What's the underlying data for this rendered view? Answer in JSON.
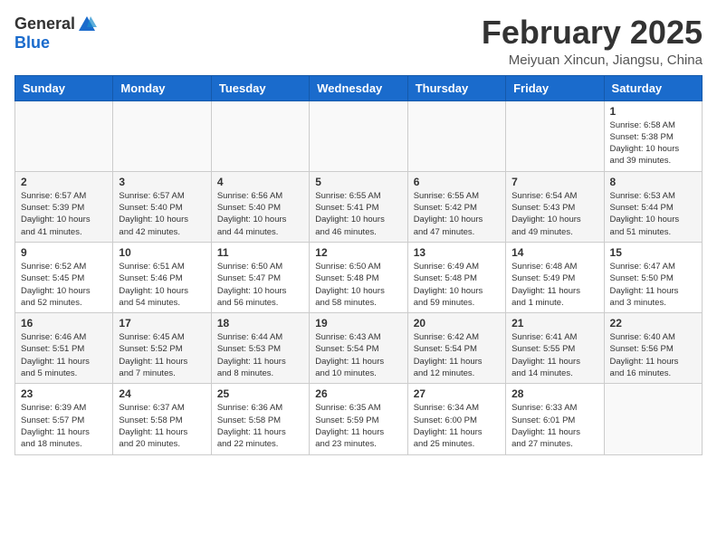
{
  "header": {
    "logo_general": "General",
    "logo_blue": "Blue",
    "month_title": "February 2025",
    "location": "Meiyuan Xincun, Jiangsu, China"
  },
  "weekdays": [
    "Sunday",
    "Monday",
    "Tuesday",
    "Wednesday",
    "Thursday",
    "Friday",
    "Saturday"
  ],
  "weeks": [
    [
      {
        "day": "",
        "info": ""
      },
      {
        "day": "",
        "info": ""
      },
      {
        "day": "",
        "info": ""
      },
      {
        "day": "",
        "info": ""
      },
      {
        "day": "",
        "info": ""
      },
      {
        "day": "",
        "info": ""
      },
      {
        "day": "1",
        "info": "Sunrise: 6:58 AM\nSunset: 5:38 PM\nDaylight: 10 hours\nand 39 minutes."
      }
    ],
    [
      {
        "day": "2",
        "info": "Sunrise: 6:57 AM\nSunset: 5:39 PM\nDaylight: 10 hours\nand 41 minutes."
      },
      {
        "day": "3",
        "info": "Sunrise: 6:57 AM\nSunset: 5:40 PM\nDaylight: 10 hours\nand 42 minutes."
      },
      {
        "day": "4",
        "info": "Sunrise: 6:56 AM\nSunset: 5:40 PM\nDaylight: 10 hours\nand 44 minutes."
      },
      {
        "day": "5",
        "info": "Sunrise: 6:55 AM\nSunset: 5:41 PM\nDaylight: 10 hours\nand 46 minutes."
      },
      {
        "day": "6",
        "info": "Sunrise: 6:55 AM\nSunset: 5:42 PM\nDaylight: 10 hours\nand 47 minutes."
      },
      {
        "day": "7",
        "info": "Sunrise: 6:54 AM\nSunset: 5:43 PM\nDaylight: 10 hours\nand 49 minutes."
      },
      {
        "day": "8",
        "info": "Sunrise: 6:53 AM\nSunset: 5:44 PM\nDaylight: 10 hours\nand 51 minutes."
      }
    ],
    [
      {
        "day": "9",
        "info": "Sunrise: 6:52 AM\nSunset: 5:45 PM\nDaylight: 10 hours\nand 52 minutes."
      },
      {
        "day": "10",
        "info": "Sunrise: 6:51 AM\nSunset: 5:46 PM\nDaylight: 10 hours\nand 54 minutes."
      },
      {
        "day": "11",
        "info": "Sunrise: 6:50 AM\nSunset: 5:47 PM\nDaylight: 10 hours\nand 56 minutes."
      },
      {
        "day": "12",
        "info": "Sunrise: 6:50 AM\nSunset: 5:48 PM\nDaylight: 10 hours\nand 58 minutes."
      },
      {
        "day": "13",
        "info": "Sunrise: 6:49 AM\nSunset: 5:48 PM\nDaylight: 10 hours\nand 59 minutes."
      },
      {
        "day": "14",
        "info": "Sunrise: 6:48 AM\nSunset: 5:49 PM\nDaylight: 11 hours\nand 1 minute."
      },
      {
        "day": "15",
        "info": "Sunrise: 6:47 AM\nSunset: 5:50 PM\nDaylight: 11 hours\nand 3 minutes."
      }
    ],
    [
      {
        "day": "16",
        "info": "Sunrise: 6:46 AM\nSunset: 5:51 PM\nDaylight: 11 hours\nand 5 minutes."
      },
      {
        "day": "17",
        "info": "Sunrise: 6:45 AM\nSunset: 5:52 PM\nDaylight: 11 hours\nand 7 minutes."
      },
      {
        "day": "18",
        "info": "Sunrise: 6:44 AM\nSunset: 5:53 PM\nDaylight: 11 hours\nand 8 minutes."
      },
      {
        "day": "19",
        "info": "Sunrise: 6:43 AM\nSunset: 5:54 PM\nDaylight: 11 hours\nand 10 minutes."
      },
      {
        "day": "20",
        "info": "Sunrise: 6:42 AM\nSunset: 5:54 PM\nDaylight: 11 hours\nand 12 minutes."
      },
      {
        "day": "21",
        "info": "Sunrise: 6:41 AM\nSunset: 5:55 PM\nDaylight: 11 hours\nand 14 minutes."
      },
      {
        "day": "22",
        "info": "Sunrise: 6:40 AM\nSunset: 5:56 PM\nDaylight: 11 hours\nand 16 minutes."
      }
    ],
    [
      {
        "day": "23",
        "info": "Sunrise: 6:39 AM\nSunset: 5:57 PM\nDaylight: 11 hours\nand 18 minutes."
      },
      {
        "day": "24",
        "info": "Sunrise: 6:37 AM\nSunset: 5:58 PM\nDaylight: 11 hours\nand 20 minutes."
      },
      {
        "day": "25",
        "info": "Sunrise: 6:36 AM\nSunset: 5:58 PM\nDaylight: 11 hours\nand 22 minutes."
      },
      {
        "day": "26",
        "info": "Sunrise: 6:35 AM\nSunset: 5:59 PM\nDaylight: 11 hours\nand 23 minutes."
      },
      {
        "day": "27",
        "info": "Sunrise: 6:34 AM\nSunset: 6:00 PM\nDaylight: 11 hours\nand 25 minutes."
      },
      {
        "day": "28",
        "info": "Sunrise: 6:33 AM\nSunset: 6:01 PM\nDaylight: 11 hours\nand 27 minutes."
      },
      {
        "day": "",
        "info": ""
      }
    ]
  ]
}
